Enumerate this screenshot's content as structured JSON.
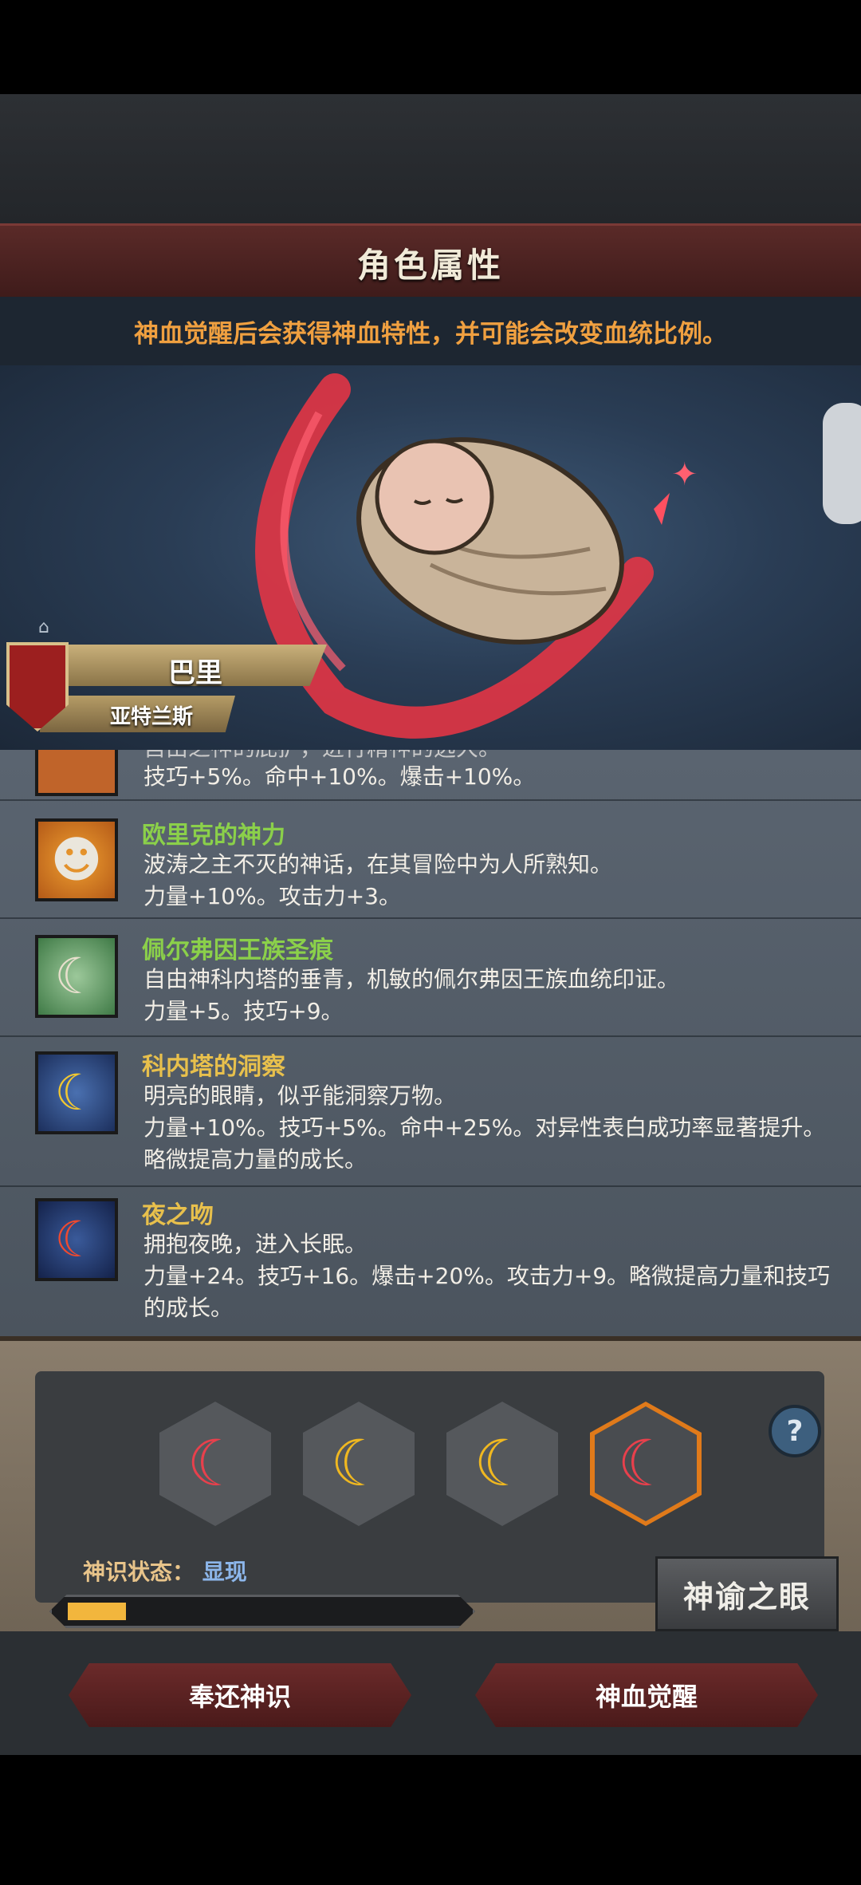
{
  "header": {
    "title": "角色属性"
  },
  "notice": "神血觉醒后会获得神血特性，并可能会改变血统比例。",
  "character": {
    "name": "巴里",
    "origin": "亚特兰斯"
  },
  "traits": [
    {
      "name": "",
      "line1": "技巧+5%。命中+10%。爆击+10%。",
      "line2": "",
      "line3": ""
    },
    {
      "name": "欧里克的神力",
      "line1": "波涛之主不灭的神话，在其冒险中为人所熟知。",
      "line2": "力量+10%。攻击力+3。",
      "line3": ""
    },
    {
      "name": "佩尔弗因王族圣痕",
      "line1": "自由神科内塔的垂青，机敏的佩尔弗因王族血统印证。",
      "line2": "力量+5。技巧+9。",
      "line3": ""
    },
    {
      "name": "科内塔的洞察",
      "line1": "明亮的眼睛，似乎能洞察万物。",
      "line2": "力量+10%。技巧+5%。命中+25%。对异性表白成功率显著提升。",
      "line3": "略微提高力量的成长。"
    },
    {
      "name": "夜之吻",
      "line1": "拥抱夜晚，进入长眠。",
      "line2": "力量+24。技巧+16。爆击+20%。攻击力+9。略微提高力量和技巧",
      "line3": "的成长。"
    }
  ],
  "panel": {
    "status_label": "神识状态：",
    "status_value": "显现",
    "progress": 0.15,
    "eye_button": "神谕之眼",
    "help": "?"
  },
  "footer": {
    "return_button": "奉还神识",
    "awaken_button": "神血觉醒"
  },
  "colors": {
    "green_name": "#8bd04a",
    "gold_name": "#e8c04c",
    "active_hex": "#e07a1a",
    "notice": "#f0a040"
  }
}
